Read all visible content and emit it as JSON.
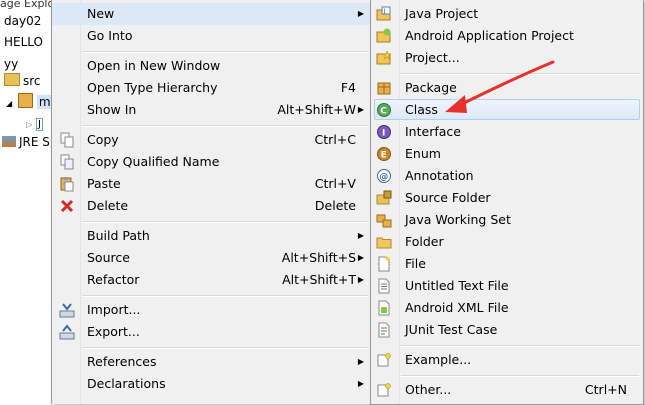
{
  "explorer": {
    "header": "age Explo",
    "items": [
      "day02",
      "HELLO",
      "yy",
      "src",
      "m",
      "J",
      "JRE S"
    ]
  },
  "menu": {
    "items": [
      {
        "label": "New",
        "accel": "",
        "submenu": true
      },
      {
        "label": "Go Into",
        "accel": "",
        "submenu": false
      },
      {
        "label": "Open in New Window",
        "accel": "",
        "submenu": false
      },
      {
        "label": "Open Type Hierarchy",
        "accel": "F4",
        "submenu": false
      },
      {
        "label": "Show In",
        "accel": "Alt+Shift+W",
        "submenu": true
      },
      {
        "label": "Copy",
        "accel": "Ctrl+C",
        "submenu": false,
        "icon": "copy-icon"
      },
      {
        "label": "Copy Qualified Name",
        "accel": "",
        "submenu": false,
        "icon": "copy-qualified-icon"
      },
      {
        "label": "Paste",
        "accel": "Ctrl+V",
        "submenu": false,
        "icon": "paste-icon"
      },
      {
        "label": "Delete",
        "accel": "Delete",
        "submenu": false,
        "icon": "delete-icon"
      },
      {
        "label": "Build Path",
        "accel": "",
        "submenu": true
      },
      {
        "label": "Source",
        "accel": "Alt+Shift+S",
        "submenu": true
      },
      {
        "label": "Refactor",
        "accel": "Alt+Shift+T",
        "submenu": true
      },
      {
        "label": "Import...",
        "accel": "",
        "submenu": false,
        "icon": "import-icon"
      },
      {
        "label": "Export...",
        "accel": "",
        "submenu": false,
        "icon": "export-icon"
      },
      {
        "label": "References",
        "accel": "",
        "submenu": true
      },
      {
        "label": "Declarations",
        "accel": "",
        "submenu": true
      }
    ]
  },
  "submenu": {
    "items": [
      {
        "label": "Java Project",
        "accel": "",
        "icon": "java-project-icon"
      },
      {
        "label": "Android Application Project",
        "accel": "",
        "icon": "android-project-icon"
      },
      {
        "label": "Project...",
        "accel": "",
        "icon": "project-icon"
      },
      {
        "label": "Package",
        "accel": "",
        "icon": "package-icon"
      },
      {
        "label": "Class",
        "accel": "",
        "icon": "class-icon",
        "highlighted": true
      },
      {
        "label": "Interface",
        "accel": "",
        "icon": "interface-icon"
      },
      {
        "label": "Enum",
        "accel": "",
        "icon": "enum-icon"
      },
      {
        "label": "Annotation",
        "accel": "",
        "icon": "annotation-icon"
      },
      {
        "label": "Source Folder",
        "accel": "",
        "icon": "source-folder-icon"
      },
      {
        "label": "Java Working Set",
        "accel": "",
        "icon": "working-set-icon"
      },
      {
        "label": "Folder",
        "accel": "",
        "icon": "folder-icon"
      },
      {
        "label": "File",
        "accel": "",
        "icon": "file-icon"
      },
      {
        "label": "Untitled Text File",
        "accel": "",
        "icon": "text-file-icon"
      },
      {
        "label": "Android XML File",
        "accel": "",
        "icon": "android-xml-icon"
      },
      {
        "label": "JUnit Test Case",
        "accel": "",
        "icon": "junit-icon"
      },
      {
        "label": "Example...",
        "accel": "",
        "icon": "example-icon"
      },
      {
        "label": "Other...",
        "accel": "Ctrl+N",
        "icon": "other-icon"
      }
    ]
  },
  "colors": {
    "menu_bg": "#f0f0f0",
    "highlight": "#dde8f7",
    "arrow": "#e8312b"
  }
}
